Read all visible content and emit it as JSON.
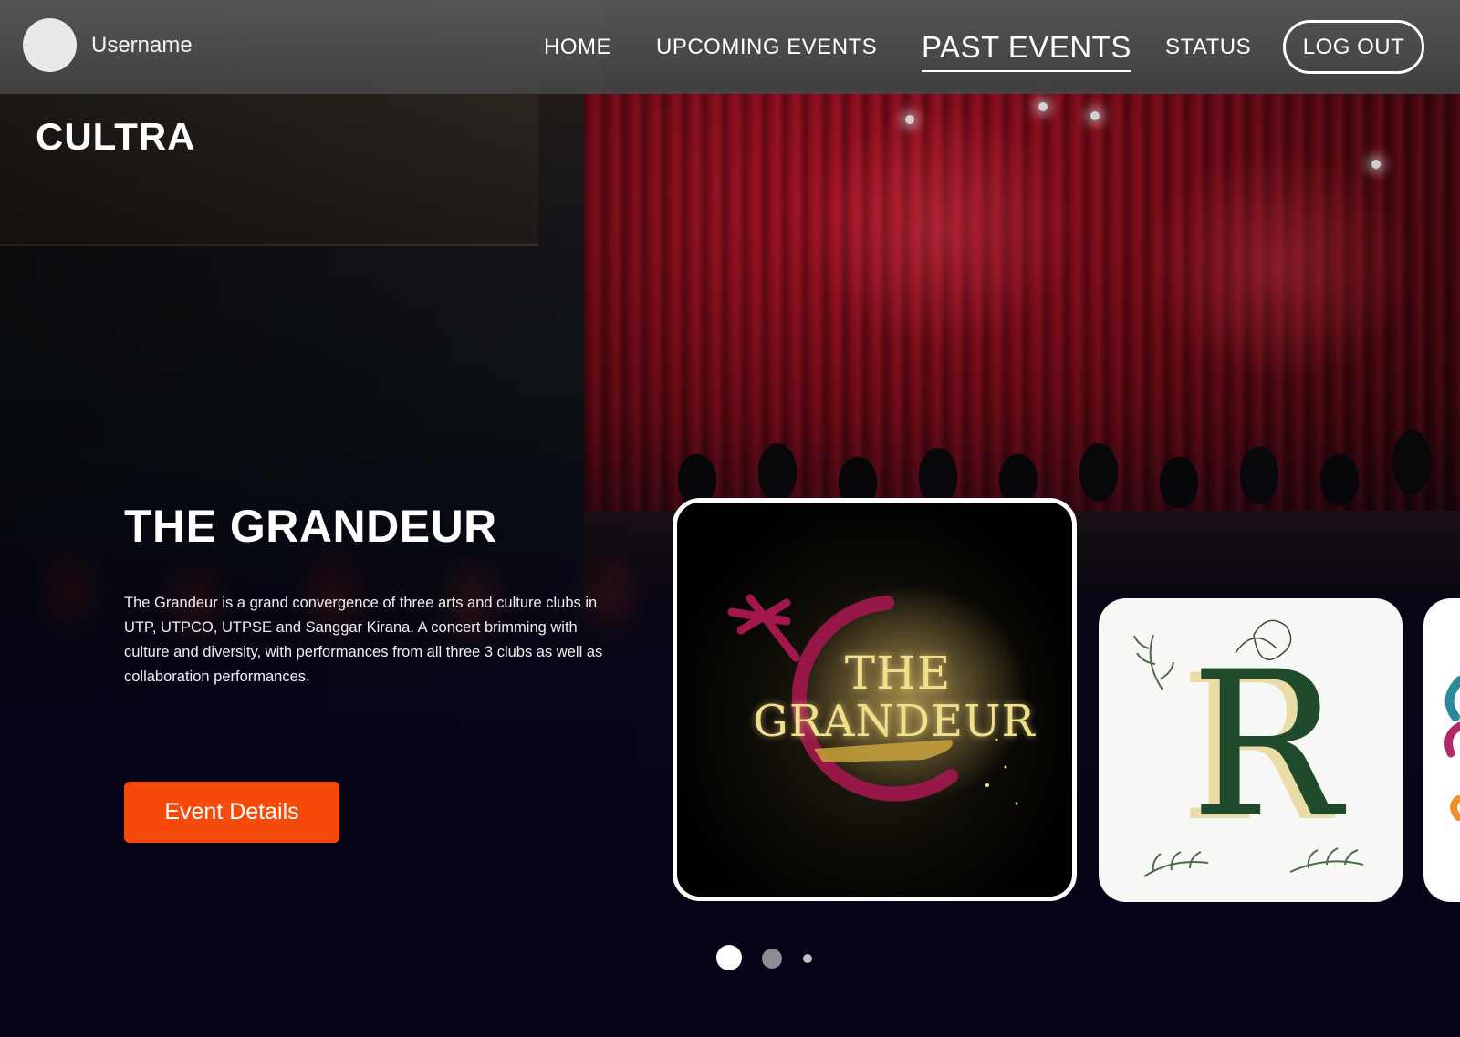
{
  "nav": {
    "username": "Username",
    "links": {
      "home": "HOME",
      "upcoming": "UPCOMING EVENTS",
      "past": "PAST EVENTS",
      "status": "STATUS"
    },
    "logout_label": "LOG OUT",
    "active_link": "past"
  },
  "brand": {
    "name": "CULTRA"
  },
  "hero": {
    "title": "THE GRANDEUR",
    "description": "The Grandeur is a grand convergence of three arts and culture clubs in UTP, UTPCO, UTPSE and Sanggar Kirana. A concert brimming with culture and diversity, with performances from all three 3 clubs as well as collaboration performances.",
    "button_label": "Event Details"
  },
  "cards": [
    {
      "logo_text_line1": "THE",
      "logo_text_line2": "GRANDEUR",
      "selected": true
    },
    {
      "logo_letter": "R",
      "selected": false
    },
    {
      "selected": false
    }
  ],
  "pager": {
    "active_index": 0,
    "count": 3
  },
  "colors": {
    "accent": "#f54a0c",
    "background": "#07061a",
    "nav_bar": "#5a5a5a",
    "curtain": "#8a0b1c",
    "grandeur_gold": "#f2df8c",
    "grandeur_magenta": "#a3174f",
    "r_logo_green": "#1f4a2c",
    "r_logo_cream": "#eadca6"
  }
}
